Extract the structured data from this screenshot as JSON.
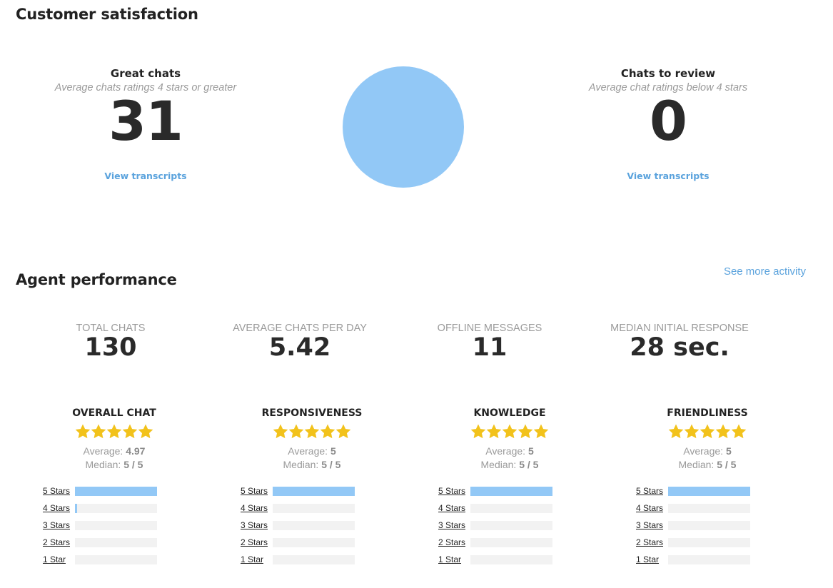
{
  "customer_satisfaction": {
    "title": "Customer satisfaction",
    "great": {
      "label": "Great chats",
      "subtitle": "Average chats ratings 4 stars or greater",
      "count": "31",
      "link": "View transcripts"
    },
    "review": {
      "label": "Chats to review",
      "subtitle": "Average chat ratings below 4 stars",
      "count": "0",
      "link": "View transcripts"
    },
    "pie_color": "#92c8f6"
  },
  "agent_performance": {
    "title": "Agent performance",
    "see_more": "See more activity",
    "stats": [
      {
        "label": "TOTAL CHATS",
        "value": "130"
      },
      {
        "label": "AVERAGE CHATS PER DAY",
        "value": "5.42"
      },
      {
        "label": "OFFLINE MESSAGES",
        "value": "11"
      },
      {
        "label": "MEDIAN INITIAL RESPONSE",
        "value": "28 sec."
      }
    ],
    "ratings": [
      {
        "title": "OVERALL CHAT",
        "avg_label": "Average:",
        "avg": "4.97",
        "med_label": "Median:",
        "med": "5 / 5",
        "stars_filled": 5,
        "bars": [
          {
            "label": "5 Stars",
            "fraction": 1.0
          },
          {
            "label": "4 Stars",
            "fraction": 0.03
          },
          {
            "label": "3 Stars",
            "fraction": 0
          },
          {
            "label": "2 Stars",
            "fraction": 0
          },
          {
            "label": "1 Star",
            "fraction": 0
          }
        ]
      },
      {
        "title": "RESPONSIVENESS",
        "avg_label": "Average:",
        "avg": "5",
        "med_label": "Median:",
        "med": "5 / 5",
        "stars_filled": 5,
        "bars": [
          {
            "label": "5 Stars",
            "fraction": 1.0
          },
          {
            "label": "4 Stars",
            "fraction": 0
          },
          {
            "label": "3 Stars",
            "fraction": 0
          },
          {
            "label": "2 Stars",
            "fraction": 0
          },
          {
            "label": "1 Star",
            "fraction": 0
          }
        ]
      },
      {
        "title": "KNOWLEDGE",
        "avg_label": "Average:",
        "avg": "5",
        "med_label": "Median:",
        "med": "5 / 5",
        "stars_filled": 5,
        "bars": [
          {
            "label": "5 Stars",
            "fraction": 1.0
          },
          {
            "label": "4 Stars",
            "fraction": 0
          },
          {
            "label": "3 Stars",
            "fraction": 0
          },
          {
            "label": "2 Stars",
            "fraction": 0
          },
          {
            "label": "1 Star",
            "fraction": 0
          }
        ]
      },
      {
        "title": "FRIENDLINESS",
        "avg_label": "Average:",
        "avg": "5",
        "med_label": "Median:",
        "med": "5 / 5",
        "stars_filled": 5,
        "bars": [
          {
            "label": "5 Stars",
            "fraction": 1.0
          },
          {
            "label": "4 Stars",
            "fraction": 0
          },
          {
            "label": "3 Stars",
            "fraction": 0
          },
          {
            "label": "2 Stars",
            "fraction": 0
          },
          {
            "label": "1 Star",
            "fraction": 0
          }
        ]
      }
    ]
  },
  "colors": {
    "accent": "#5ba3dd",
    "bar_fill": "#92c8f6",
    "star": "#f2c21b",
    "track": "#f2f2f2"
  },
  "icons": {
    "star": "star-icon"
  }
}
